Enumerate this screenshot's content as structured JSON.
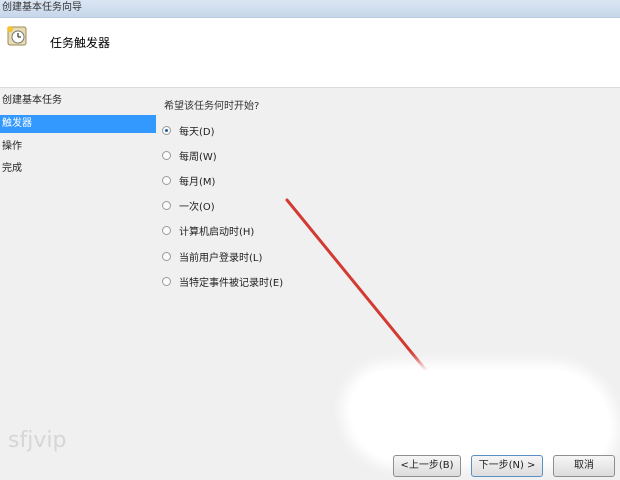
{
  "window": {
    "title": "创建基本任务向导"
  },
  "header": {
    "title": "任务触发器",
    "icon": "clock-task-icon"
  },
  "sidebar": {
    "items": [
      {
        "label": "创建基本任务",
        "active": false
      },
      {
        "label": "触发器",
        "active": true
      },
      {
        "label": "操作",
        "active": false
      },
      {
        "label": "完成",
        "active": false
      }
    ]
  },
  "main": {
    "prompt": "希望该任务何时开始?",
    "options": [
      {
        "label": "每天(D)",
        "checked": true
      },
      {
        "label": "每周(W)",
        "checked": false
      },
      {
        "label": "每月(M)",
        "checked": false
      },
      {
        "label": "一次(O)",
        "checked": false
      },
      {
        "label": "计算机启动时(H)",
        "checked": false
      },
      {
        "label": "当前用户登录时(L)",
        "checked": false
      },
      {
        "label": "当特定事件被记录时(E)",
        "checked": false
      }
    ]
  },
  "buttons": {
    "back": "<上一步(B)",
    "next": "下一步(N) >",
    "cancel": "取消"
  },
  "watermark": "sfjvip",
  "colors": {
    "selection": "#3399ff",
    "annotation_arrow": "#d23a32"
  }
}
